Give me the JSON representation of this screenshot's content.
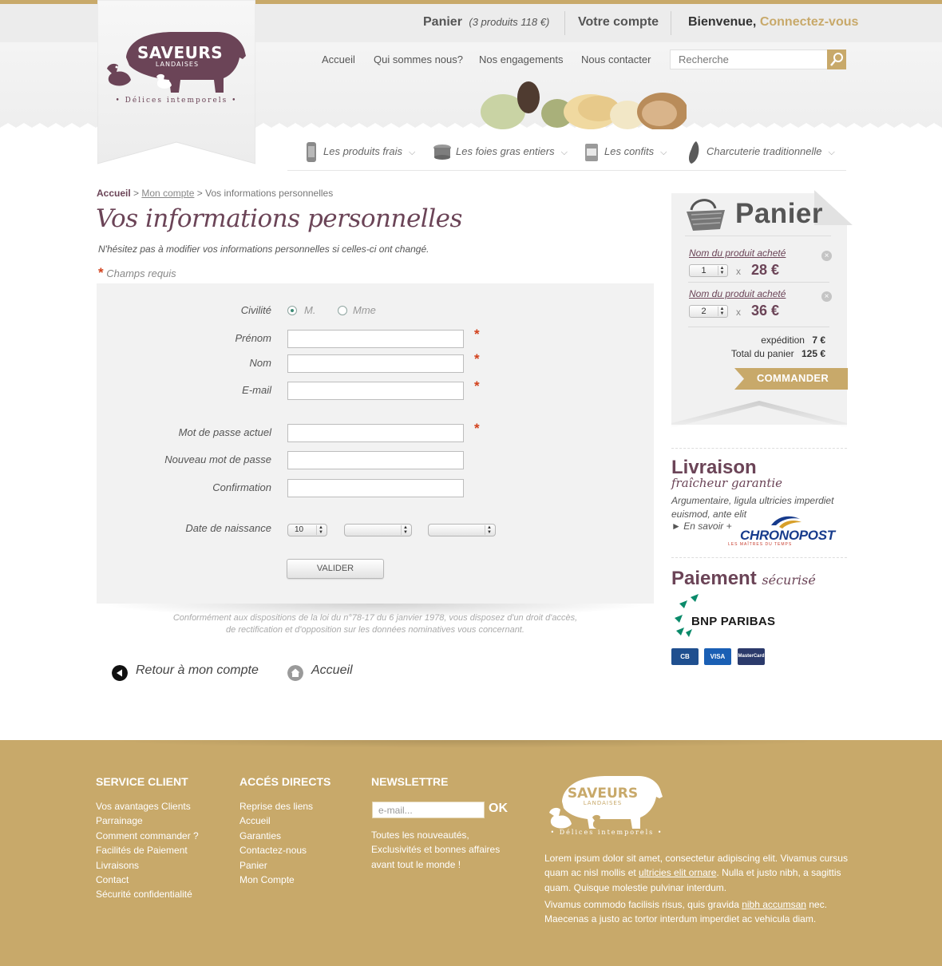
{
  "colors": {
    "accent_gold": "#c8a96a",
    "brand_plum": "#6b4457",
    "required_red": "#d2411c"
  },
  "logo": {
    "name": "SAVEURS",
    "sub": "LANDAISES",
    "tagline": "• Délices intemporels •"
  },
  "topbar": {
    "cart_label": "Panier",
    "cart_detail": "(3 produits 118 €)",
    "account_label": "Votre compte",
    "welcome_label": "Bienvenue,",
    "login_link": "Connectez-vous"
  },
  "nav": {
    "items": [
      "Accueil",
      "Qui sommes nous?",
      "Nos engagements",
      "Nous contacter"
    ],
    "search_placeholder": "Recherche"
  },
  "categories": [
    {
      "label": "Les produits frais",
      "icon": "jar-icon"
    },
    {
      "label": "Les foies gras entiers",
      "icon": "terrine-icon"
    },
    {
      "label": "Les confits",
      "icon": "can-icon"
    },
    {
      "label": "Charcuterie traditionnelle",
      "icon": "sausage-icon"
    }
  ],
  "breadcrumb": {
    "home": "Accueil",
    "sep1": ">",
    "account": "Mon compte",
    "sep2": ">",
    "current": "Vos informations personnelles"
  },
  "page": {
    "title": "Vos informations personnelles",
    "intro": "N'hésitez pas à modifier vos informations personnelles si celles-ci ont changé.",
    "required_star": "*",
    "required_note": "Champs requis"
  },
  "form": {
    "civility_label": "Civilité",
    "civility_options": [
      "M.",
      "Mme"
    ],
    "civility_selected": "M.",
    "firstname_label": "Prénom",
    "lastname_label": "Nom",
    "email_label": "E-mail",
    "current_password_label": "Mot de passe actuel",
    "new_password_label": "Nouveau mot de passe",
    "confirm_label": "Confirmation",
    "birthdate_label": "Date de naissance",
    "birth_day": "10",
    "birth_month": "",
    "birth_year": "",
    "validate_label": "VALIDER",
    "star": "*"
  },
  "legal": {
    "line1": "Conformément aux dispositions de la loi du n°78-17 du 6 janvier 1978, vous disposez d'un droit d'accès,",
    "line2": "de rectification et d'opposition sur les données nominatives vous concernant."
  },
  "bottom_links": {
    "back": "Retour à mon compte",
    "home": "Accueil"
  },
  "cart": {
    "title": "Panier",
    "items": [
      {
        "name": "Nom du produit acheté",
        "qty": "1",
        "x": "x",
        "price": "28 €"
      },
      {
        "name": "Nom du produit acheté",
        "qty": "2",
        "x": "x",
        "price": "36 €"
      }
    ],
    "shipping_label": "expédition",
    "shipping_value": "7 €",
    "total_label": "Total du panier",
    "total_value": "125 €",
    "order_label": "COMMANDER"
  },
  "delivery": {
    "title": "Livraison",
    "subtitle": "fraîcheur garantie",
    "text": "Argumentaire, ligula ultricies imperdiet euismod, ante elit",
    "more": "► En savoir +",
    "partner": "CHRONOPOST",
    "partner_tagline": "LES MAÎTRES DU TEMPS"
  },
  "payment": {
    "title": "Paiement",
    "subtitle": "sécurisé",
    "bank": "BNP PARIBAS",
    "cards": [
      "CB",
      "VISA",
      "MasterCard"
    ]
  },
  "footer": {
    "service_title": "SERVICE CLIENT",
    "service_items": [
      "Vos avantages Clients",
      "Parrainage",
      "Comment commander ?",
      "Facilités de Paiement",
      "Livraisons",
      "Contact",
      "Sécurité confidentialité"
    ],
    "access_title": "ACCÉS DIRECTS",
    "access_items": [
      "Reprise des liens",
      "Accueil",
      "Garanties",
      "Contactez-nous",
      "Panier",
      "Mon Compte"
    ],
    "newsletter_title": "NEWSLETTRE",
    "newsletter_placeholder": "e-mail...",
    "newsletter_ok": "OK",
    "newsletter_text": "Toutes les nouveautés, Exclusivités et bonnes affaires avant tout le monde !",
    "p1_a": "Lorem ipsum dolor sit amet, consectetur adipiscing elit. Vivamus cursus quam ac nisl mollis et ",
    "p1_link": "ultricies elit ornare",
    "p1_b": ". Nulla et justo nibh, a sagittis quam. Quisque molestie pulvinar interdum.",
    "p2_a": "Vivamus commodo facilisis risus, quis gravida ",
    "p2_link": "nibh accumsan",
    "p2_b": " nec. Maecenas a justo ac tortor interdum imperdiet ac vehicula diam."
  }
}
